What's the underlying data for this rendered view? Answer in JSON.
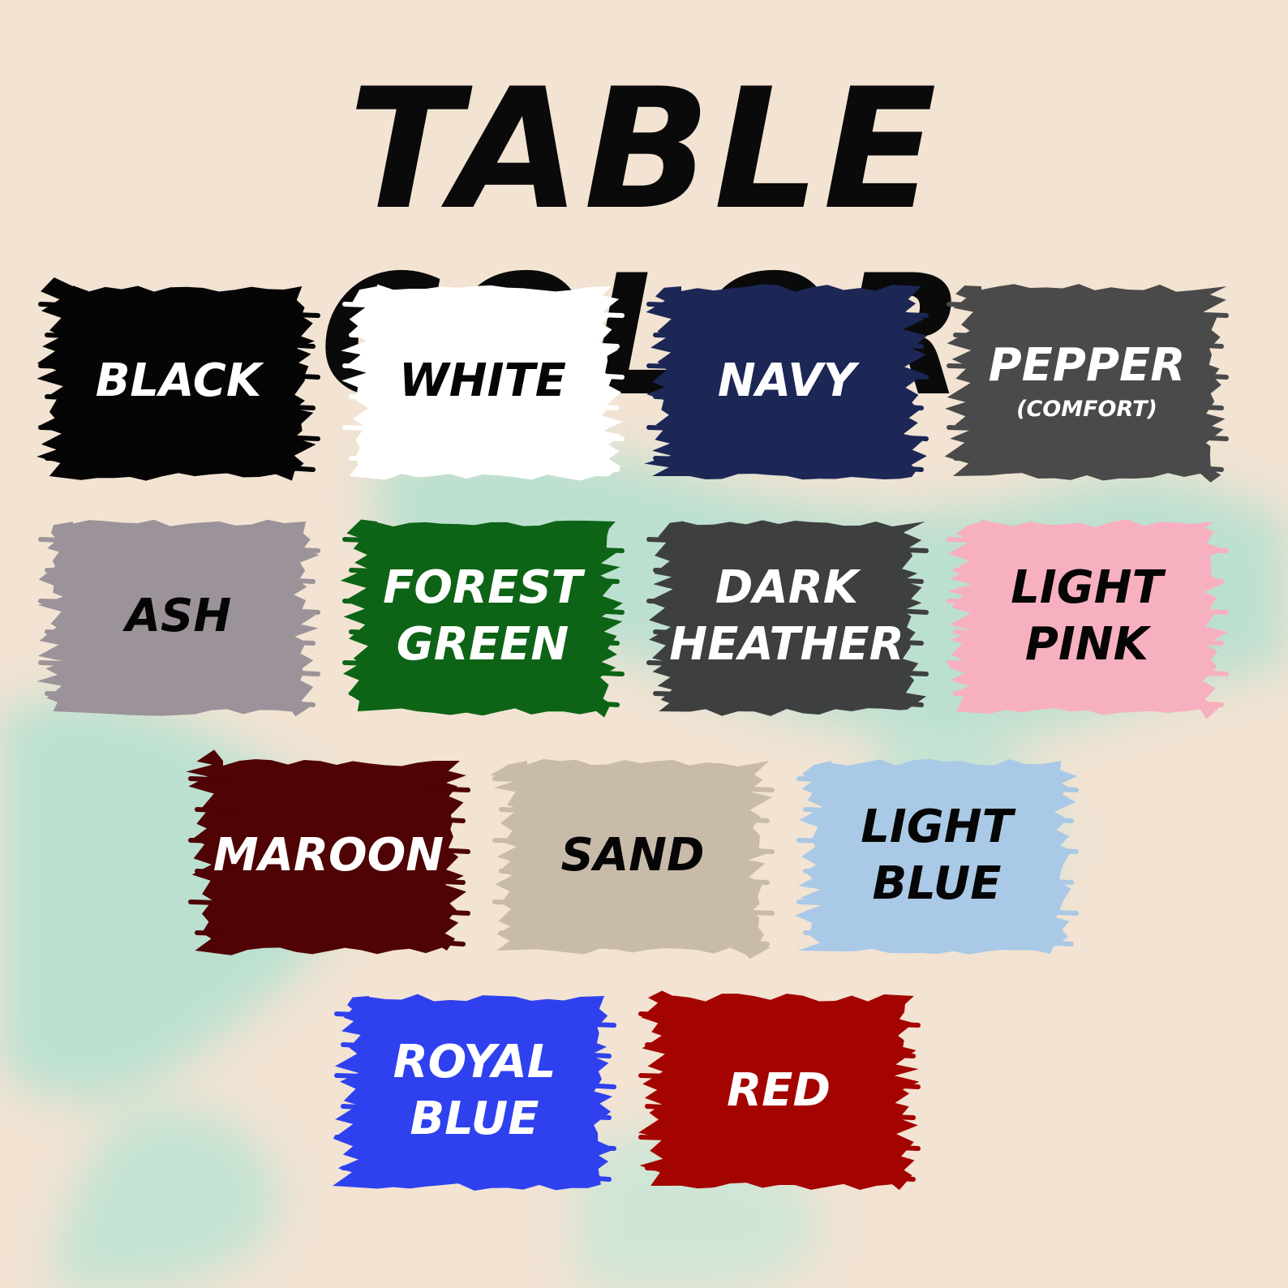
{
  "title": "TABLE COLOR",
  "background": "#f2e3d3",
  "accent_splash": "#a9e0d0",
  "swatches": [
    {
      "lines": [
        "BLACK"
      ],
      "sub": "",
      "fill": "#050505",
      "text_color": "#ffffff"
    },
    {
      "lines": [
        "WHITE"
      ],
      "sub": "",
      "fill": "#ffffff",
      "text_color": "#050505"
    },
    {
      "lines": [
        "NAVY"
      ],
      "sub": "",
      "fill": "#1c2756",
      "text_color": "#ffffff"
    },
    {
      "lines": [
        "PEPPER"
      ],
      "sub": "(COMFORT)",
      "fill": "#4a4a4a",
      "text_color": "#ffffff"
    },
    {
      "lines": [
        "ASH"
      ],
      "sub": "",
      "fill": "#9b9399",
      "text_color": "#050505"
    },
    {
      "lines": [
        "FOREST",
        "GREEN"
      ],
      "sub": "",
      "fill": "#0d6416",
      "text_color": "#ffffff"
    },
    {
      "lines": [
        "DARK",
        "HEATHER"
      ],
      "sub": "",
      "fill": "#3e4040",
      "text_color": "#ffffff"
    },
    {
      "lines": [
        "LIGHT",
        "PINK"
      ],
      "sub": "",
      "fill": "#f7b0bf",
      "text_color": "#050505"
    },
    {
      "lines": [
        "MAROON"
      ],
      "sub": "",
      "fill": "#4f0304",
      "text_color": "#ffffff"
    },
    {
      "lines": [
        "SAND"
      ],
      "sub": "",
      "fill": "#c9bba9",
      "text_color": "#050505"
    },
    {
      "lines": [
        "LIGHT",
        "BLUE"
      ],
      "sub": "",
      "fill": "#a9c9e6",
      "text_color": "#050505"
    },
    {
      "lines": [
        "ROYAL",
        "BLUE"
      ],
      "sub": "",
      "fill": "#2f41ee",
      "text_color": "#ffffff"
    },
    {
      "lines": [
        "RED"
      ],
      "sub": "",
      "fill": "#a40400",
      "text_color": "#ffffff"
    }
  ]
}
